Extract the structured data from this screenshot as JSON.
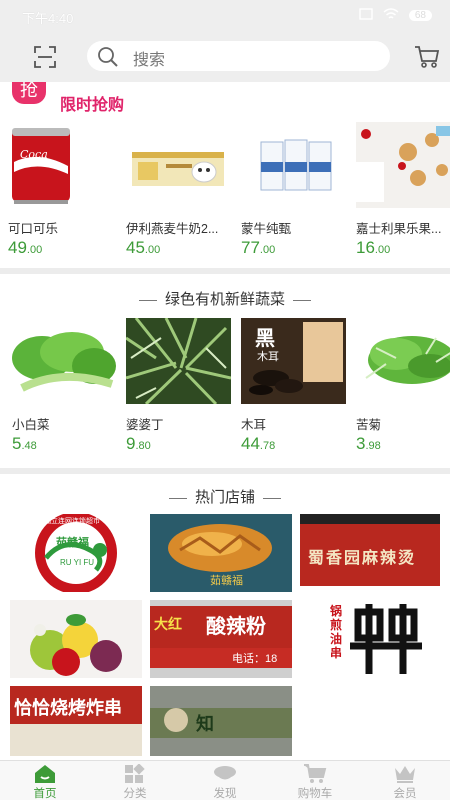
{
  "status_bar": {
    "time": "下午4:40",
    "battery": "68"
  },
  "header": {
    "search_placeholder": "搜索"
  },
  "flash_sale": {
    "badge": "抢",
    "title": "限时抢购",
    "products": [
      {
        "name": "可口可乐",
        "price_int": "49",
        "price_dec": ".00"
      },
      {
        "name": "伊利燕麦牛奶2...",
        "price_int": "45",
        "price_dec": ".00"
      },
      {
        "name": "蒙牛纯甄",
        "price_int": "77",
        "price_dec": ".00"
      },
      {
        "name": "嘉士利果乐果...",
        "price_int": "16",
        "price_dec": ".00"
      }
    ]
  },
  "organic": {
    "title": "绿色有机新鲜蔬菜",
    "products": [
      {
        "name": "小白菜",
        "price_int": "5",
        "price_dec": ".48"
      },
      {
        "name": "婆婆丁",
        "price_int": "9",
        "price_dec": ".80"
      },
      {
        "name": "木耳",
        "price_int": "44",
        "price_dec": ".78"
      },
      {
        "name": "苦菊",
        "price_int": "3",
        "price_dec": ".98"
      }
    ],
    "image_text": {
      "mu_er_1": "黑",
      "mu_er_2": "木耳"
    }
  },
  "hot_shops": {
    "title": "热门店铺",
    "shop_texts": {
      "s1_logo": "茹赣福",
      "s1_ring": "茹赣福立连网连锁超市",
      "s1_sub": "RU YI FU",
      "s2_sign": "茹赣福",
      "s3_sign": "蜀香园麻辣烫",
      "s5_sign_a": "大红",
      "s5_sign_b": "酸辣粉",
      "s5_phone": "电话：18",
      "s6_side": "锅煎油串",
      "s7_sign": "恰恰烧烤炸串",
      "s8_sign": "知"
    }
  },
  "bottom_nav": [
    {
      "label": "首页"
    },
    {
      "label": "分类"
    },
    {
      "label": "发现"
    },
    {
      "label": "购物车"
    },
    {
      "label": "会员"
    }
  ],
  "colors": {
    "accent_green": "#3d9b38",
    "flash_pink": "#e0246a"
  }
}
